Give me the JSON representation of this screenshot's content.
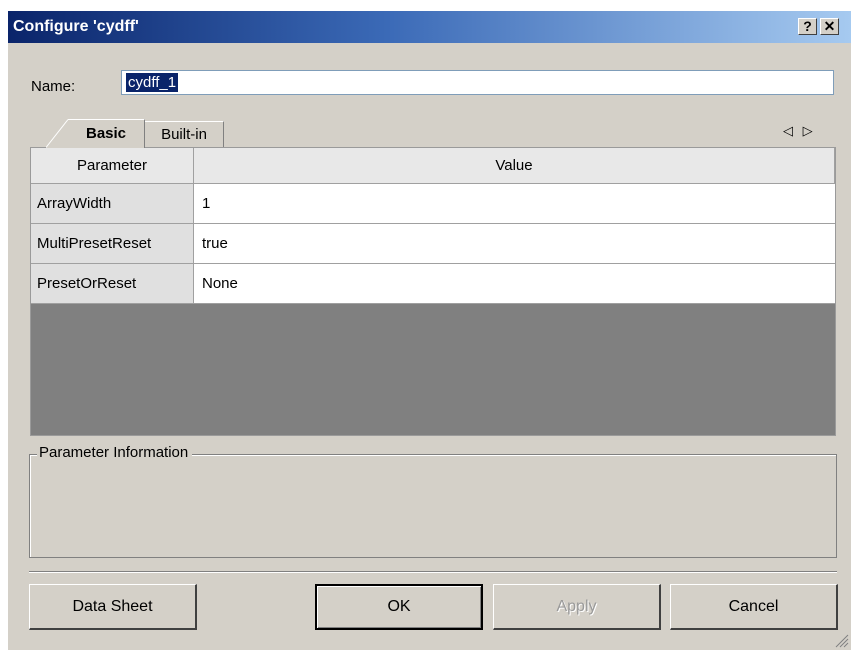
{
  "window": {
    "title": "Configure 'cydff'"
  },
  "titlebar": {
    "help_label": "?",
    "close_label": "✕"
  },
  "name_field": {
    "label": "Name:",
    "value": "cydff_1"
  },
  "tabs": [
    {
      "label": "Basic",
      "selected": true
    },
    {
      "label": "Built-in",
      "selected": false
    }
  ],
  "tab_nav": {
    "label": "◁ ▷"
  },
  "grid": {
    "headers": {
      "parameter": "Parameter",
      "value": "Value"
    },
    "rows": [
      {
        "name": "ArrayWidth",
        "value": "1"
      },
      {
        "name": "MultiPresetReset",
        "value": "true"
      },
      {
        "name": "PresetOrReset",
        "value": "None"
      }
    ]
  },
  "info": {
    "label": "Parameter Information"
  },
  "buttons": {
    "datasheet": "Data Sheet",
    "ok": "OK",
    "apply": "Apply",
    "cancel": "Cancel"
  },
  "colors": {
    "title_gradient_start": "#0a246a",
    "title_gradient_end": "#a6caf0",
    "dialog_face": "#d4d0c8",
    "grid_background": "#808080",
    "selection": "#0a246a"
  }
}
